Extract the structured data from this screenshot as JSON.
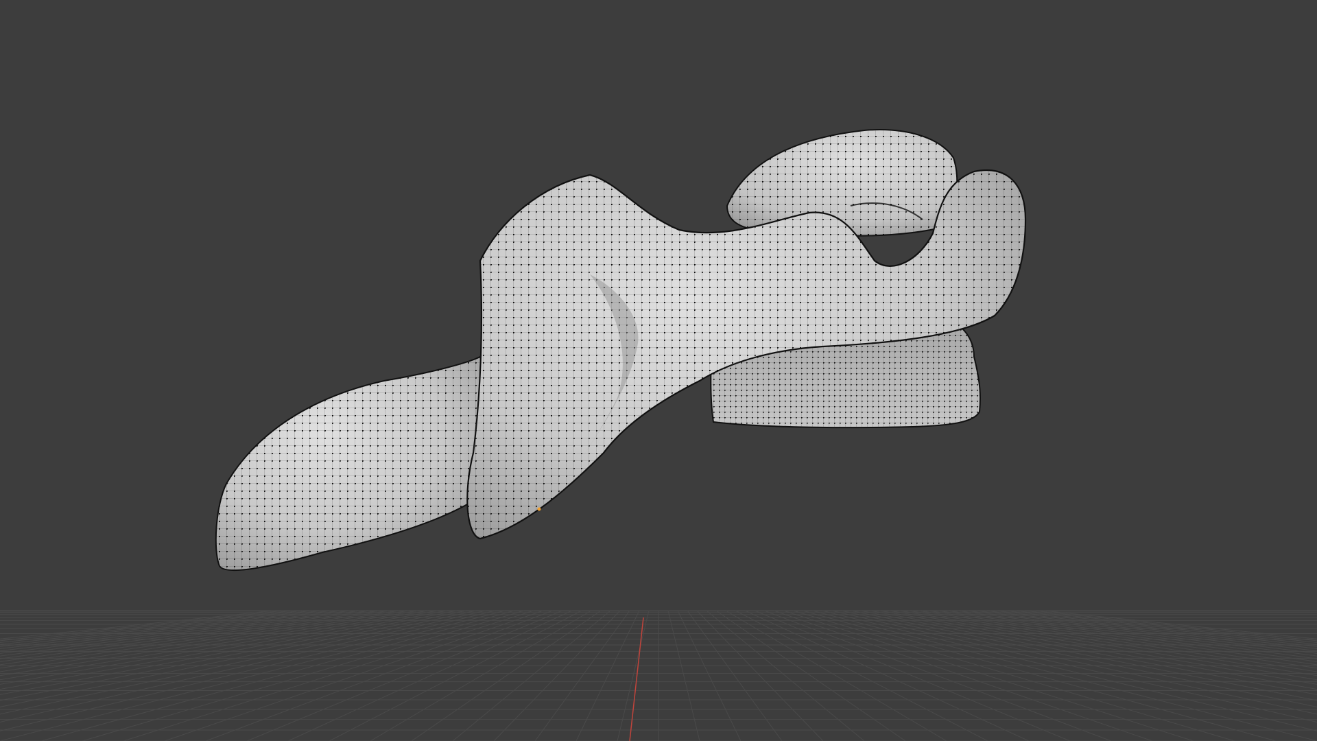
{
  "viewport": {
    "background_color": "#3d3d3d",
    "grid_line_color": "#4a4a4a",
    "y_axis_color": "#c1443c",
    "mesh": {
      "face_color": "#cfcfcf",
      "shade_color": "#a9a9a9",
      "wire_color": "#1c1c1c",
      "vertex_color": "#121212"
    },
    "origin_point_color": "#f0a030"
  }
}
